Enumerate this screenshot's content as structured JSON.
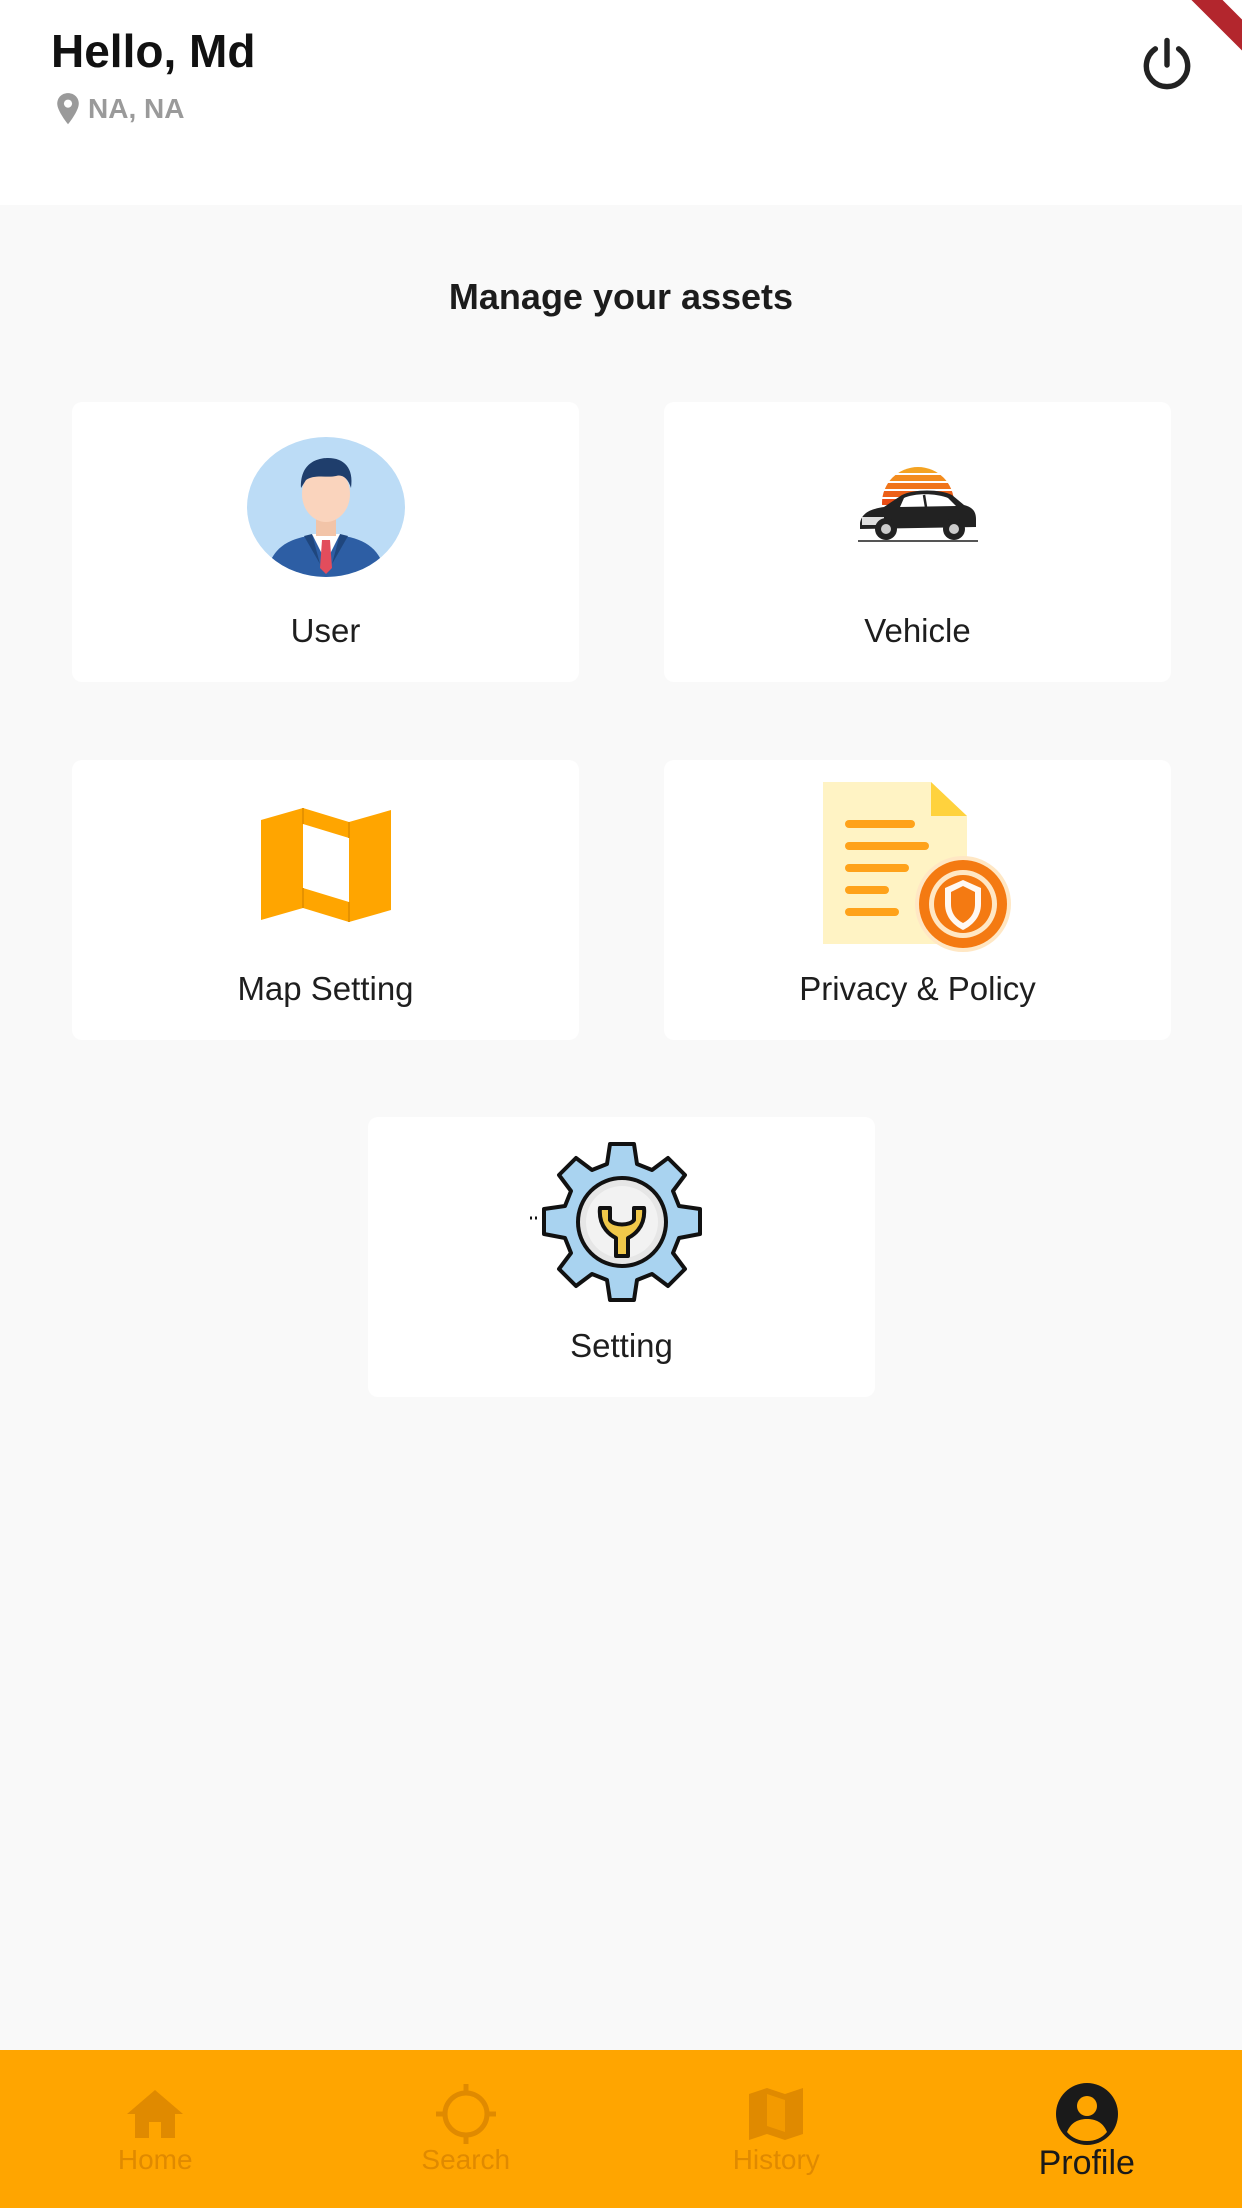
{
  "header": {
    "greeting": "Hello, Md",
    "location": "NA, NA"
  },
  "main": {
    "section_title": "Manage your assets",
    "cards": [
      {
        "label": "User",
        "icon": "user-avatar-icon"
      },
      {
        "label": "Vehicle",
        "icon": "car-icon"
      },
      {
        "label": "Map Setting",
        "icon": "map-icon"
      },
      {
        "label": "Privacy & Policy",
        "icon": "privacy-document-icon"
      },
      {
        "label": "Setting",
        "icon": "gear-wrench-icon"
      }
    ]
  },
  "bottom_nav": {
    "items": [
      {
        "label": "Home",
        "icon": "home-icon",
        "active": false
      },
      {
        "label": "Search",
        "icon": "crosshair-icon",
        "active": false
      },
      {
        "label": "History",
        "icon": "map-icon",
        "active": false
      },
      {
        "label": "Profile",
        "icon": "account-circle-icon",
        "active": true
      }
    ]
  },
  "colors": {
    "accent": "#ffa500",
    "background": "#f9f9f9",
    "card": "#ffffff",
    "nav_inactive": "#e08a00"
  }
}
